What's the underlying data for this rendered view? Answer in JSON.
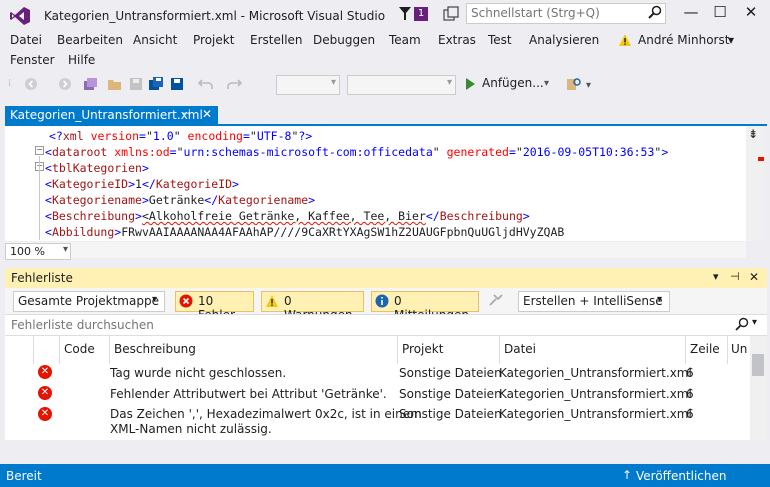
{
  "window": {
    "title": "Kategorien_Untransformiert.xml - Microsoft Visual Studio",
    "notification_count": "1",
    "quick_launch_placeholder": "Schnellstart (Strg+Q)",
    "minimize": "—",
    "maximize": "☐",
    "close": "✕"
  },
  "menu": {
    "items": [
      "Datei",
      "Bearbeiten",
      "Ansicht",
      "Projekt",
      "Erstellen",
      "Debuggen",
      "Team",
      "Extras",
      "Test",
      "Analysieren"
    ],
    "items_row2": [
      "Fenster",
      "Hilfe"
    ],
    "user": "André Minhorst",
    "user_dropdown": "▾"
  },
  "toolbar": {
    "attach_label": "Anfügen..."
  },
  "document": {
    "tab_label": "Kategorien_Untransformiert.xml",
    "zoom": "100 %",
    "lines": [
      {
        "parts": [
          [
            "b",
            "<?"
          ],
          [
            "m",
            "xml"
          ],
          [
            "r",
            " version"
          ],
          [
            "b",
            "="
          ],
          [
            "k",
            "\""
          ],
          [
            "b",
            "1.0"
          ],
          [
            "k",
            "\""
          ],
          [
            "r",
            " encoding"
          ],
          [
            "b",
            "="
          ],
          [
            "k",
            "\""
          ],
          [
            "b",
            "UTF-8"
          ],
          [
            "k",
            "\""
          ],
          [
            "b",
            "?>"
          ]
        ]
      },
      {
        "parts": [
          [
            "b",
            "<"
          ],
          [
            "m",
            "dataroot"
          ],
          [
            "r",
            " xmlns:od"
          ],
          [
            "b",
            "="
          ],
          [
            "k",
            "\""
          ],
          [
            "b",
            "urn:schemas-microsoft-com:officedata"
          ],
          [
            "k",
            "\""
          ],
          [
            "r",
            " generated"
          ],
          [
            "b",
            "="
          ],
          [
            "k",
            "\""
          ],
          [
            "b",
            "2016-09-05T10:36:53"
          ],
          [
            "k",
            "\""
          ],
          [
            "b",
            ">"
          ]
        ]
      },
      {
        "parts": [
          [
            "b",
            "<"
          ],
          [
            "m",
            "tblKategorien"
          ],
          [
            "b",
            ">"
          ]
        ]
      },
      {
        "parts": [
          [
            "b",
            "<"
          ],
          [
            "m",
            "KategorieID"
          ],
          [
            "b",
            ">"
          ],
          [
            "k",
            "1"
          ],
          [
            "b",
            "</"
          ],
          [
            "m",
            "KategorieID"
          ],
          [
            "b",
            ">"
          ]
        ]
      },
      {
        "parts": [
          [
            "b",
            "<"
          ],
          [
            "m",
            "Kategoriename"
          ],
          [
            "b",
            ">"
          ],
          [
            "k",
            "Getränke"
          ],
          [
            "b",
            "</"
          ],
          [
            "m",
            "Kategoriename"
          ],
          [
            "b",
            ">"
          ]
        ]
      },
      {
        "parts": [
          [
            "b",
            "<"
          ],
          [
            "m",
            "Beschreibung"
          ],
          [
            "b",
            ">"
          ],
          [
            "s",
            "<Alkoholfreie Getränke, Kaffee, Tee, Bier"
          ],
          [
            "b",
            "</"
          ],
          [
            "m",
            "Beschreibung"
          ],
          [
            "b",
            ">"
          ]
        ]
      },
      {
        "parts": [
          [
            "b",
            "<"
          ],
          [
            "m",
            "Abbildung"
          ],
          [
            "b",
            ">"
          ],
          [
            "k",
            "FRwvAAIAAAANAA4AFAAhAP////9CaXRtYXAgSW1hZ2UAUGFpbnQuUGljdHVyZQAB"
          ]
        ]
      }
    ]
  },
  "error_list": {
    "title": "Fehlerliste",
    "scope": "Gesamte Projektmappe",
    "errors_label": "10 Fehler",
    "warnings_label": "0 Warnungen",
    "messages_label": "0 Mitteilungen",
    "build_filter": "Erstellen + IntelliSense",
    "search_placeholder": "Fehlerliste durchsuchen",
    "columns": [
      "Code",
      "Beschreibung",
      "Projekt",
      "Datei",
      "Zeile",
      "Un"
    ],
    "rows": [
      {
        "description": "Tag wurde nicht geschlossen.",
        "description2": "",
        "project": "Sonstige Dateien",
        "file": "Kategorien_Untransformiert.xml",
        "line": "6"
      },
      {
        "description": "Fehlender Attributwert bei Attribut 'Getränke'.",
        "description2": "",
        "project": "Sonstige Dateien",
        "file": "Kategorien_Untransformiert.xml",
        "line": "6"
      },
      {
        "description": "Das Zeichen ',', Hexadezimalwert 0x2c, ist in einem",
        "description2": "XML-Namen nicht zulässig.",
        "project": "Sonstige Dateien",
        "file": "Kategorien_Untransformiert.xml",
        "line": "6"
      }
    ]
  },
  "status": {
    "text": "Bereit",
    "publish": "Veröffentlichen"
  },
  "colors": {
    "accent": "#007acc",
    "vs_purple": "#68217a",
    "error_red": "#e51400",
    "tool_header_yellow": "#fff0b3"
  }
}
